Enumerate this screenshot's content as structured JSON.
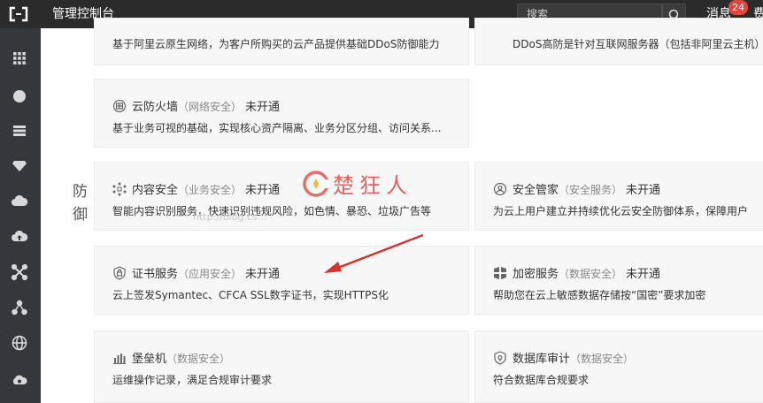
{
  "topbar": {
    "title": "管理控制台",
    "search_placeholder": "搜索",
    "messages_label": "消息",
    "messages_count": "24",
    "fee_label": "费用"
  },
  "sidebar": {
    "icons": [
      "grid-icon",
      "circle-icon",
      "storage-icon",
      "diamond-icon",
      "cloud-icon",
      "cloud-upload-icon",
      "network-icon",
      "cluster-icon",
      "globe-icon",
      "gear-cloud-icon"
    ]
  },
  "section": {
    "label_1": "防",
    "label_2": "御"
  },
  "cards": {
    "top_left_desc": "基于阿里云原生网络，为客户所购买的云产品提供基础DDoS防御能力",
    "top_right_desc": "DDoS高防是针对互联网服务器（包括非阿里云主机）",
    "firewall": {
      "name": "云防火墙",
      "category": "（网络安全）",
      "status": "未开通",
      "desc": "基于业务可视的基础，实现核心资产隔离、业务分区分组、访问关系..."
    },
    "content_security": {
      "name": "内容安全",
      "category": "（业务安全）",
      "status": "未开通",
      "desc": "智能内容识别服务，快速识别违规风险，如色情、暴恐、垃圾广告等"
    },
    "security_butler": {
      "name": "安全管家",
      "category": "（安全服务）",
      "status": "未开通",
      "desc": "为云上用户建立并持续优化云安全防御体系，保障用户"
    },
    "certificate": {
      "name": "证书服务",
      "category": "（应用安全）",
      "status": "未开通",
      "desc": "云上签发Symantec、CFCA SSL数字证书，实现HTTPS化"
    },
    "encryption": {
      "name": "加密服务",
      "category": "（数据安全）",
      "status": "未开通",
      "desc": "帮助您在云上敏感数据存储按“国密”要求加密"
    },
    "bastion": {
      "name": "堡垒机",
      "category": "（数据安全）",
      "status": "",
      "desc": "运维操作记录，满足合规审计要求"
    },
    "db_audit": {
      "name": "数据库审计",
      "category": "（数据安全）",
      "status": "",
      "desc": "符合数据库合规要求"
    }
  },
  "watermark": {
    "text": "楚狂人",
    "url": "http://blog.cs..."
  },
  "colors": {
    "topbar": "#2b2b2b",
    "sidebar": "#34373b",
    "badge": "#e0463e",
    "arrow": "#d9312b"
  }
}
